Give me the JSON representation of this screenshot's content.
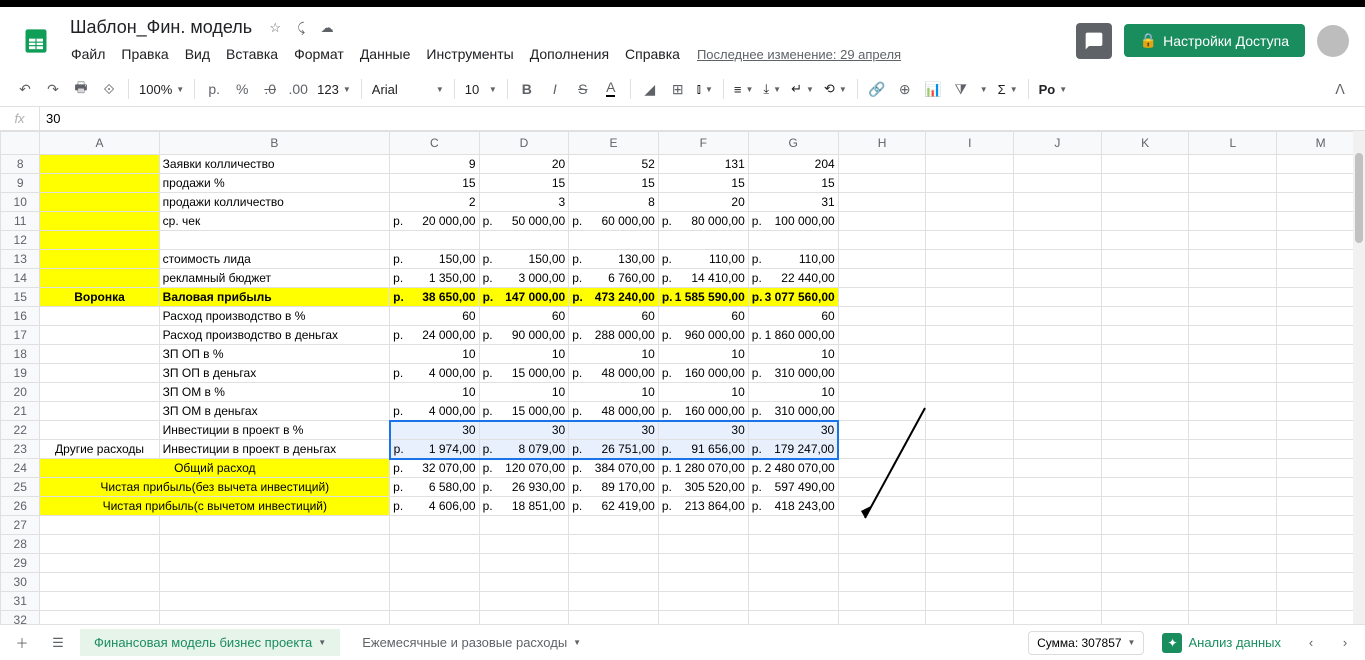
{
  "doc_title": "Шаблон_Фин. модель",
  "last_modified": "Последнее изменение: 29 апреля",
  "share_label": "Настройки Доступа",
  "menu": [
    "Файл",
    "Правка",
    "Вид",
    "Вставка",
    "Формат",
    "Данные",
    "Инструменты",
    "Дополнения",
    "Справка"
  ],
  "toolbar": {
    "zoom": "100%",
    "currency": "р.",
    "percent": "%",
    "dec_dec": ".0",
    "inc_dec": ".00",
    "format": "123",
    "font": "Arial",
    "font_size": "10",
    "formula": "Pо"
  },
  "formula_bar": {
    "fx": "fx",
    "value": "30"
  },
  "columns": [
    "A",
    "B",
    "C",
    "D",
    "E",
    "F",
    "G",
    "H",
    "I",
    "J",
    "K",
    "L",
    "M"
  ],
  "rows": [
    {
      "n": 8,
      "a": "",
      "ay": true,
      "b": "Заявки колличество",
      "vals": [
        "9",
        "20",
        "52",
        "131",
        "204"
      ]
    },
    {
      "n": 9,
      "a": "",
      "ay": true,
      "b": "продажи %",
      "vals": [
        "15",
        "15",
        "15",
        "15",
        "15"
      ]
    },
    {
      "n": 10,
      "a": "",
      "ay": true,
      "b": "продажи колличество",
      "vals": [
        "2",
        "3",
        "8",
        "20",
        "31"
      ]
    },
    {
      "n": 11,
      "a": "",
      "ay": true,
      "b": "ср. чек",
      "cur": true,
      "vals": [
        "20 000,00",
        "50 000,00",
        "60 000,00",
        "80 000,00",
        "100 000,00"
      ]
    },
    {
      "n": 12,
      "a": "",
      "ay": true,
      "b": "",
      "vals": [
        "",
        "",
        "",
        "",
        ""
      ]
    },
    {
      "n": 13,
      "a": "",
      "ay": true,
      "b": "стоимость лида",
      "cur": true,
      "vals": [
        "150,00",
        "150,00",
        "130,00",
        "110,00",
        "110,00"
      ]
    },
    {
      "n": 14,
      "a": "",
      "ay": true,
      "b": "рекламный бюджет",
      "cur": true,
      "vals": [
        "1 350,00",
        "3 000,00",
        "6 760,00",
        "14 410,00",
        "22 440,00"
      ]
    },
    {
      "n": 15,
      "a": "Воронка",
      "ay": true,
      "b": "Валовая прибыль",
      "by": true,
      "bold": true,
      "cur": true,
      "cy": true,
      "vals": [
        "38 650,00",
        "147 000,00",
        "473 240,00",
        "1 585 590,00",
        "3 077 560,00"
      ]
    },
    {
      "n": 16,
      "a": "",
      "b": "Расход производство в %",
      "vals": [
        "60",
        "60",
        "60",
        "60",
        "60"
      ]
    },
    {
      "n": 17,
      "a": "",
      "b": "Расход производство в деньгах",
      "cur": true,
      "vals": [
        "24 000,00",
        "90 000,00",
        "288 000,00",
        "960 000,00",
        "1 860 000,00"
      ]
    },
    {
      "n": 18,
      "a": "",
      "b": "ЗП ОП в %",
      "vals": [
        "10",
        "10",
        "10",
        "10",
        "10"
      ]
    },
    {
      "n": 19,
      "a": "",
      "b": "ЗП ОП в деньгах",
      "cur": true,
      "vals": [
        "4 000,00",
        "15 000,00",
        "48 000,00",
        "160 000,00",
        "310 000,00"
      ]
    },
    {
      "n": 20,
      "a": "",
      "b": "ЗП ОМ в %",
      "vals": [
        "10",
        "10",
        "10",
        "10",
        "10"
      ]
    },
    {
      "n": 21,
      "a": "",
      "b": "ЗП ОМ в деньгах",
      "cur": true,
      "vals": [
        "4 000,00",
        "15 000,00",
        "48 000,00",
        "160 000,00",
        "310 000,00"
      ]
    },
    {
      "n": 22,
      "a": "",
      "b": "Инвестиции в проект в %",
      "sel": true,
      "vals": [
        "30",
        "30",
        "30",
        "30",
        "30"
      ]
    },
    {
      "n": 23,
      "a": "Другие расходы",
      "b": "Инвестиции в проект в деньгах",
      "sel": true,
      "cur": true,
      "vals": [
        "1 974,00",
        "8 079,00",
        "26 751,00",
        "91 656,00",
        "179 247,00"
      ]
    },
    {
      "n": 24,
      "a": "Общий расход",
      "aby": true,
      "mergecenter": true,
      "cur": true,
      "vals": [
        "32 070,00",
        "120 070,00",
        "384 070,00",
        "1 280 070,00",
        "2 480 070,00"
      ]
    },
    {
      "n": 25,
      "a": "Чистая прибыль(без вычета инвестиций)",
      "aby": true,
      "mergecenter": true,
      "cur": true,
      "vals": [
        "6 580,00",
        "26 930,00",
        "89 170,00",
        "305 520,00",
        "597 490,00"
      ]
    },
    {
      "n": 26,
      "a": "Чистая прибыль(с вычетом инвестиций)",
      "aby": true,
      "mergecenter": true,
      "cur": true,
      "vals": [
        "4 606,00",
        "18 851,00",
        "62 419,00",
        "213 864,00",
        "418 243,00"
      ]
    },
    {
      "n": 27,
      "a": "",
      "b": "",
      "vals": [
        "",
        "",
        "",
        "",
        ""
      ]
    },
    {
      "n": 28,
      "a": "",
      "b": "",
      "vals": [
        "",
        "",
        "",
        "",
        ""
      ]
    },
    {
      "n": 29,
      "a": "",
      "b": "",
      "vals": [
        "",
        "",
        "",
        "",
        ""
      ]
    },
    {
      "n": 30,
      "a": "",
      "b": "",
      "vals": [
        "",
        "",
        "",
        "",
        ""
      ]
    },
    {
      "n": 31,
      "a": "",
      "b": "",
      "vals": [
        "",
        "",
        "",
        "",
        ""
      ]
    },
    {
      "n": 32,
      "a": "",
      "b": "",
      "vals": [
        "",
        "",
        "",
        "",
        ""
      ]
    }
  ],
  "currency_symbol": "р.",
  "sheets": {
    "active": "Финансовая модель бизнес проекта",
    "other": "Ежемесячные и разовые расходы"
  },
  "bottom": {
    "sum_label": "Сумма: 307857",
    "analyze": "Анализ данных"
  }
}
